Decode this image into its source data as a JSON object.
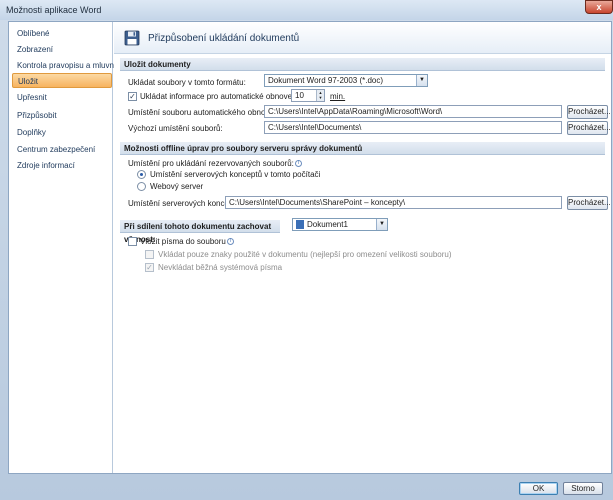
{
  "window": {
    "title": "Možnosti aplikace Word",
    "close_label": "x"
  },
  "sidebar": {
    "items": [
      {
        "label": "Oblíbené",
        "active": false
      },
      {
        "label": "Zobrazení",
        "active": false
      },
      {
        "label": "Kontrola pravopisu a mluvnice",
        "active": false
      },
      {
        "label": "Uložit",
        "active": true
      },
      {
        "label": "Upřesnit",
        "active": false
      },
      {
        "label": "Přizpůsobit",
        "active": false
      },
      {
        "label": "Doplňky",
        "active": false
      },
      {
        "label": "Centrum zabezpečení",
        "active": false
      },
      {
        "label": "Zdroje informací",
        "active": false
      }
    ]
  },
  "header": {
    "title": "Přizpůsobení ukládání dokumentů",
    "icon": "floppy-disk-icon"
  },
  "save_section": {
    "title": "Uložit dokumenty",
    "format_label": "Ukládat soubory v tomto formátu:",
    "format_value": "Dokument Word 97-2003 (*.doc)",
    "autorecover_label": "Ukládat informace pro automatické obnovení po",
    "autorecover_checked": true,
    "autorecover_minutes": "10",
    "minutes_unit": "min.",
    "autorecover_location_label": "Umístění souboru automatického obnovení:",
    "autorecover_location_value": "C:\\Users\\Intel\\AppData\\Roaming\\Microsoft\\Word\\",
    "default_location_label": "Výchozí umístění souborů:",
    "default_location_value": "C:\\Users\\Intel\\Documents\\",
    "browse_label": "Procházet..."
  },
  "offline_section": {
    "title": "Možnosti offline úprav pro soubory serveru správy dokumentů",
    "location_question": "Umístění pro ukládání rezervovaných souborů:",
    "option_local": "Umístění serverových konceptů v tomto počítači",
    "option_web": "Webový server",
    "selected_option": "local",
    "drafts_label": "Umístění serverových konceptů:",
    "drafts_value": "C:\\Users\\Intel\\Documents\\SharePoint – koncepty\\",
    "browse_label": "Procházet..."
  },
  "fidelity_section": {
    "title": "Při sdílení tohoto dokumentu zachovat věrnost:",
    "document_value": "Dokument1",
    "embed_fonts_label": "Vložit písma do souboru",
    "embed_fonts_checked": false,
    "embed_used_chars_label": "Vkládat pouze znaky použité v dokumentu (nejlepší pro omezení velikosti souboru)",
    "embed_used_chars_checked": false,
    "no_system_fonts_label": "Nevkládat běžná systémová písma",
    "no_system_fonts_checked": true
  },
  "footer": {
    "ok_label": "OK",
    "cancel_label": "Storno"
  }
}
